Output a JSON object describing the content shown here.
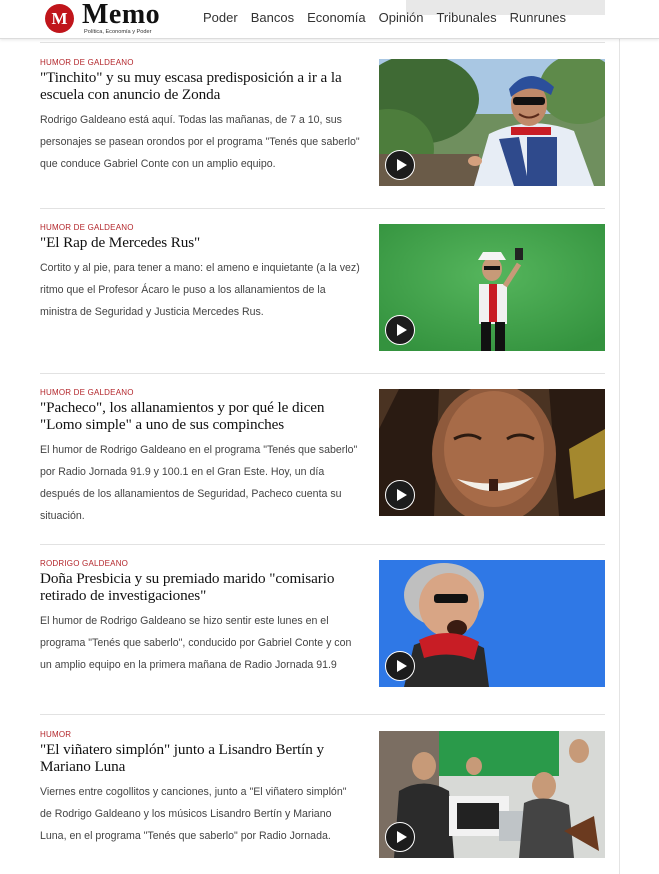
{
  "header": {
    "logo_badge": "M",
    "logo_word": "Memo",
    "logo_tagline": "Política, Economía y Poder",
    "nav": [
      "Poder",
      "Bancos",
      "Economía",
      "Opinión",
      "Tribunales",
      "Runrunes"
    ]
  },
  "articles": [
    {
      "section": "HUMOR DE GALDEANO",
      "title": "\"Tinchito\" y su muy escasa predisposición a ir a la escuela con anuncio de Zonda",
      "excerpt": "Rodrigo Galdeano está aquí. Todas las mañanas, de 7 a 10, sus personajes se pasean orondos por el programa \"Tenés que saberlo\" que conduce Gabriel Conte con un amplio equipo."
    },
    {
      "section": "HUMOR DE GALDEANO",
      "title": "\"El Rap de Mercedes Rus\"",
      "excerpt": "Cortito y al pie, para tener a mano: el ameno e inquietante (a la vez) ritmo que el Profesor Ácaro le puso a los allanamientos de la ministra de Seguridad y Justicia Mercedes Rus."
    },
    {
      "section": "HUMOR DE GALDEANO",
      "title": "\"Pacheco\", los allanamientos y por qué le dicen \"Lomo simple\" a uno de sus compinches",
      "excerpt": "El humor de Rodrigo Galdeano en el programa \"Tenés que saberlo\" por Radio Jornada 91.9 y 100.1 en el Gran Este. Hoy, un día después de los allanamientos de Seguridad, Pacheco cuenta su situación."
    },
    {
      "section": "RODRIGO GALDEANO",
      "title": "Doña Presbicia y su premiado marido \"comisario retirado de investigaciones\"",
      "excerpt": "El humor de Rodrigo Galdeano se hizo sentir este lunes en el programa \"Tenés que saberlo\", conducido por Gabriel Conte y con un amplio equipo en la primera mañana de Radio Jornada 91.9"
    },
    {
      "section": "HUMOR",
      "title": "\"El viñatero simplón\" junto a Lisandro Bertín y Mariano Luna",
      "excerpt": "Viernes entre cogollitos y canciones, junto a \"El viñatero simplón\" de Rodrigo Galdeano y los músicos Lisandro Bertín y Mariano Luna, en el programa \"Tenés que saberlo\" por Radio Jornada."
    }
  ],
  "colors": {
    "accent": "#b3262b",
    "logo_red": "#c0151b"
  }
}
